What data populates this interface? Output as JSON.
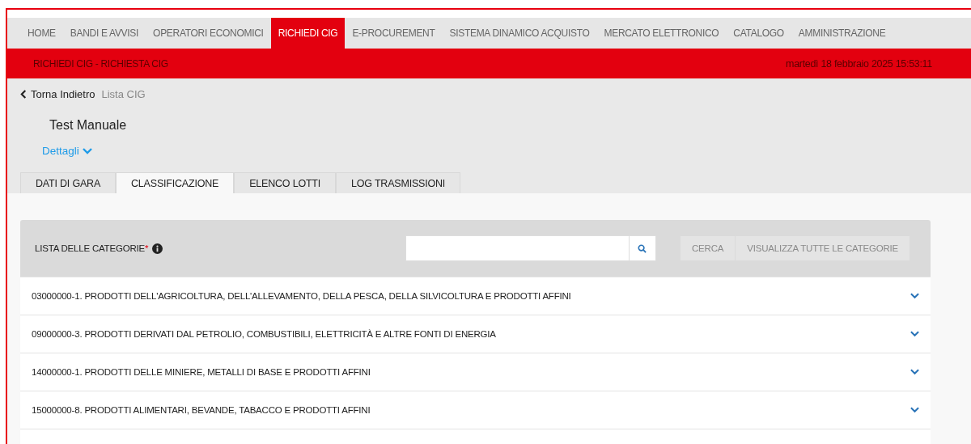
{
  "nav": [
    {
      "label": "HOME",
      "selected": false
    },
    {
      "label": "BANDI E AVVISI",
      "selected": false
    },
    {
      "label": "OPERATORI ECONOMICI",
      "selected": false
    },
    {
      "label": "RICHIEDI CIG",
      "selected": true
    },
    {
      "label": "E-PROCUREMENT",
      "selected": false
    },
    {
      "label": "SISTEMA DINAMICO ACQUISTO",
      "selected": false
    },
    {
      "label": "MERCATO ELETTRONICO",
      "selected": false
    },
    {
      "label": "CATALOGO",
      "selected": false
    },
    {
      "label": "AMMINISTRAZIONE",
      "selected": false
    }
  ],
  "banner": {
    "title": "RICHIEDI CIG - RICHIESTA CIG",
    "datetime": "martedì 18 febbraio 2025 15:53:11"
  },
  "breadcrumb": {
    "back": "Torna Indietro",
    "current": "Lista CIG"
  },
  "page_title": "Test Manuale",
  "details_link": "Dettagli",
  "tabs": [
    {
      "label": "DATI DI GARA",
      "selected": false
    },
    {
      "label": "CLASSIFICAZIONE",
      "selected": true
    },
    {
      "label": "ELENCO LOTTI",
      "selected": false
    },
    {
      "label": "LOG TRASMISSIONI",
      "selected": false
    }
  ],
  "categories_panel": {
    "label": "LISTA DELLE CATEGORIE",
    "required_mark": "*",
    "buttons": [
      {
        "label": "CERCA",
        "disabled": true
      },
      {
        "label": "VISUALIZZA TUTTE LE CATEGORIE",
        "disabled": true
      }
    ],
    "items": [
      {
        "label": "03000000-1. PRODOTTI DELL'AGRICOLTURA, DELL'ALLEVAMENTO, DELLA PESCA, DELLA SILVICOLTURA E PRODOTTI AFFINI",
        "expanded": false
      },
      {
        "label": "09000000-3. PRODOTTI DERIVATI DAL PETROLIO, COMBUSTIBILI, ELETTRICITÀ E ALTRE FONTI DI ENERGIA",
        "expanded": false
      },
      {
        "label": "14000000-1. PRODOTTI DELLE MINIERE, METALLI DI BASE E PRODOTTI AFFINI",
        "expanded": false
      },
      {
        "label": "15000000-8. PRODOTTI ALIMENTARI, BEVANDE, TABACCO E PRODOTTI AFFINI",
        "expanded": false
      }
    ]
  }
}
